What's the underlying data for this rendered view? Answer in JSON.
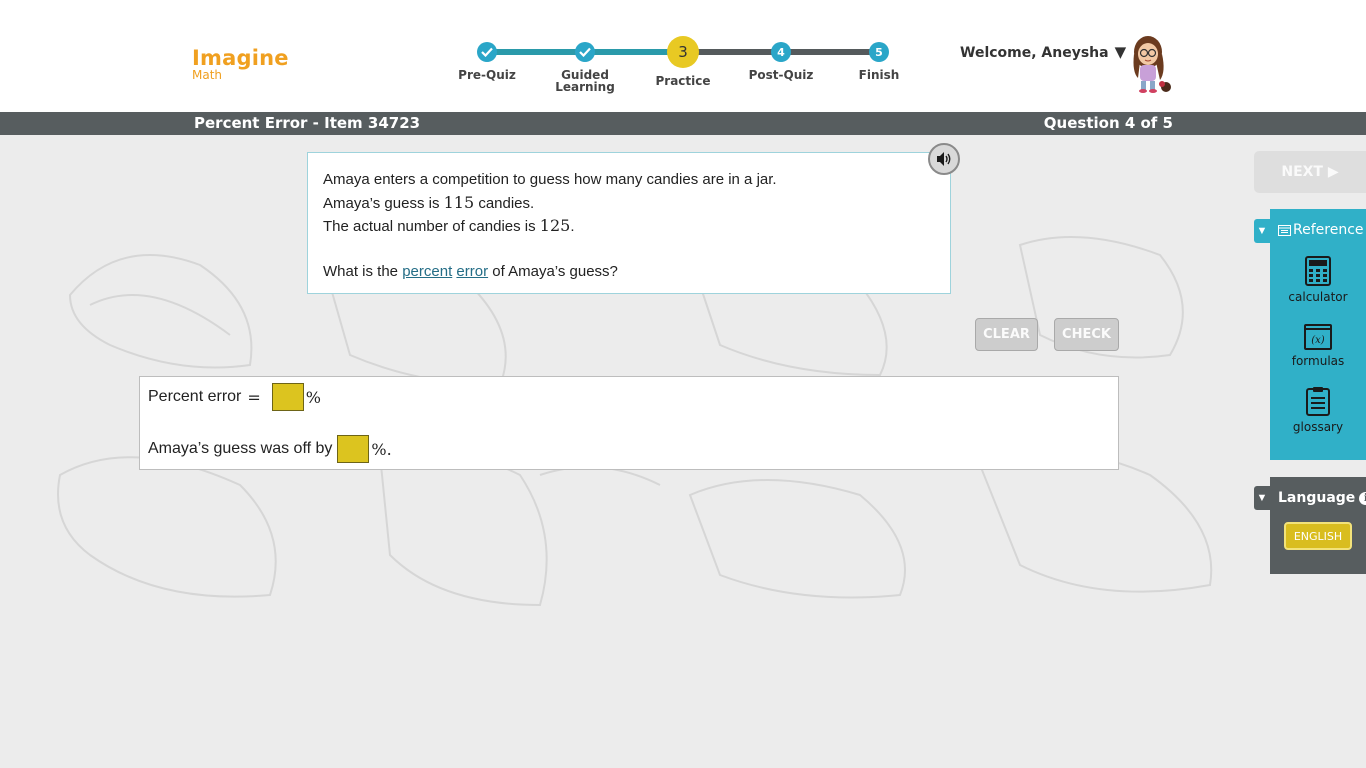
{
  "brand": {
    "name": "Imagine",
    "product": "Math",
    "color": "#f0a020"
  },
  "progress": {
    "steps": [
      {
        "label": "Pre-Quiz",
        "state": "done",
        "icon": "check-icon"
      },
      {
        "label": "Guided Learning",
        "state": "done",
        "icon": "check-icon"
      },
      {
        "label": "Practice",
        "number": "3",
        "state": "current"
      },
      {
        "label": "Post-Quiz",
        "number": "4",
        "state": "upcoming"
      },
      {
        "label": "Finish",
        "number": "5",
        "state": "upcoming"
      }
    ]
  },
  "user": {
    "welcome": "Welcome, Aneysha",
    "menu_icon": "caret-down-icon"
  },
  "titlebar": {
    "title": "Percent Error - Item 34723",
    "question_counter": "Question 4 of 5"
  },
  "question": {
    "line1": "Amaya enters a competition to guess how many candies are in a jar.",
    "line2_pre": "Amaya’s guess is ",
    "guess": "115",
    "line2_post": " candies.",
    "line3_pre": "The actual number of candies is ",
    "actual": "125",
    "line3_post": ".",
    "prompt_pre": "What is the ",
    "link1": "percent",
    "link2": "error",
    "prompt_post": " of Amaya’s guess?",
    "audio_icon": "speaker-icon"
  },
  "actions": {
    "clear": "CLEAR",
    "check": "CHECK"
  },
  "answer": {
    "row1_label": "Percent error",
    "equals": "=",
    "percent_sign": "%",
    "row2_label": "Amaya’s guess was off by",
    "row2_suffix": "%."
  },
  "sidebar": {
    "next": "NEXT ▶",
    "reference": {
      "title": "Reference",
      "tools": [
        {
          "label": "calculator",
          "icon": "calculator-icon"
        },
        {
          "label": "formulas",
          "icon": "formulas-icon"
        },
        {
          "label": "glossary",
          "icon": "clipboard-icon"
        }
      ]
    },
    "language": {
      "title": "Language",
      "selected": "ENGLISH"
    }
  },
  "colors": {
    "accent": "#30b0c8",
    "progress_done": "#2a9aaa",
    "current_step": "#e8c923",
    "answer_input": "#dcc41f",
    "titlebar": "#575d5f"
  }
}
